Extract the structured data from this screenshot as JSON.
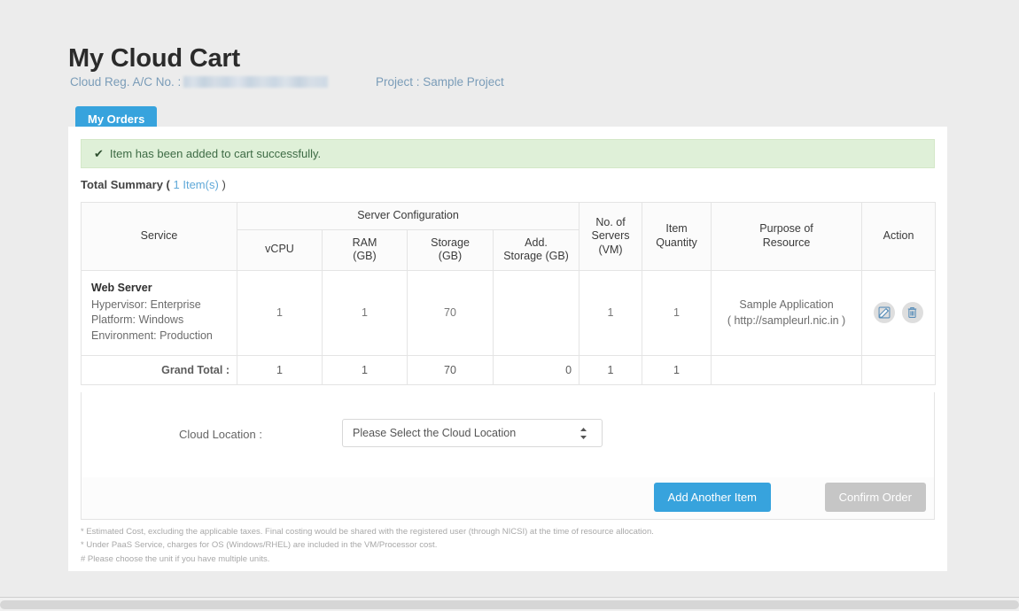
{
  "header": {
    "title": "My Cloud Cart",
    "account_label": "Cloud Reg. A/C No. :",
    "account_value_redacted": "",
    "project": "Project : Sample Project",
    "tab_my_orders": "My Orders"
  },
  "alert": {
    "icon": "check-icon",
    "message": "Item has been added to cart successfully."
  },
  "summary": {
    "label": "Total Summary (",
    "count": "1 Item(s)",
    "close": ")"
  },
  "table": {
    "group_header": "Server Configuration",
    "headers": {
      "service": "Service",
      "vcpu": "vCPU",
      "ram": "RAM\n(GB)",
      "ram_line1": "RAM",
      "ram_line2": "(GB)",
      "storage_line1": "Storage",
      "storage_line2": "(GB)",
      "addstorage_line1": "Add.",
      "addstorage_line2": "Storage (GB)",
      "servers_line1": "No. of",
      "servers_line2": "Servers",
      "servers_line3": "(VM)",
      "itemqty_line1": "Item",
      "itemqty_line2": "Quantity",
      "purpose_line1": "Purpose of",
      "purpose_line2": "Resource",
      "action": "Action"
    },
    "rows": [
      {
        "service_name": "Web Server",
        "service_detail_1": "Hypervisor: Enterprise",
        "service_detail_2": "Platform: Windows",
        "service_detail_3": "Environment: Production",
        "vcpu": "1",
        "ram": "1",
        "storage": "70",
        "add_storage": "",
        "servers": "1",
        "item_quantity": "1",
        "purpose_line1": "Sample Application",
        "purpose_line2": "( http://sampleurl.nic.in )",
        "edit_icon": "edit-icon",
        "delete_icon": "trash-icon"
      }
    ],
    "grand_total": {
      "label": "Grand Total :",
      "vcpu": "1",
      "ram": "1",
      "storage": "70",
      "add_storage": "0",
      "servers": "1",
      "item_quantity": "1"
    }
  },
  "location": {
    "label": "Cloud Location :",
    "selected": "Please Select the Cloud Location",
    "options": [
      "Please Select the Cloud Location"
    ]
  },
  "actions": {
    "add_another": "Add Another Item",
    "confirm_order": "Confirm Order"
  },
  "notes": [
    "* Estimated Cost, excluding the applicable taxes. Final costing would be shared with the registered user (through NICSI) at the time of resource allocation.",
    "* Under PaaS Service, charges for OS (Windows/RHEL) are included in the VM/Processor cost.",
    "# Please choose the unit if you have multiple units."
  ],
  "colors": {
    "accent": "#37a3dd",
    "success_bg": "#dff0d8",
    "success_text": "#3e6b45",
    "muted_button": "#c6c6c6",
    "page_bg": "#ececec"
  }
}
